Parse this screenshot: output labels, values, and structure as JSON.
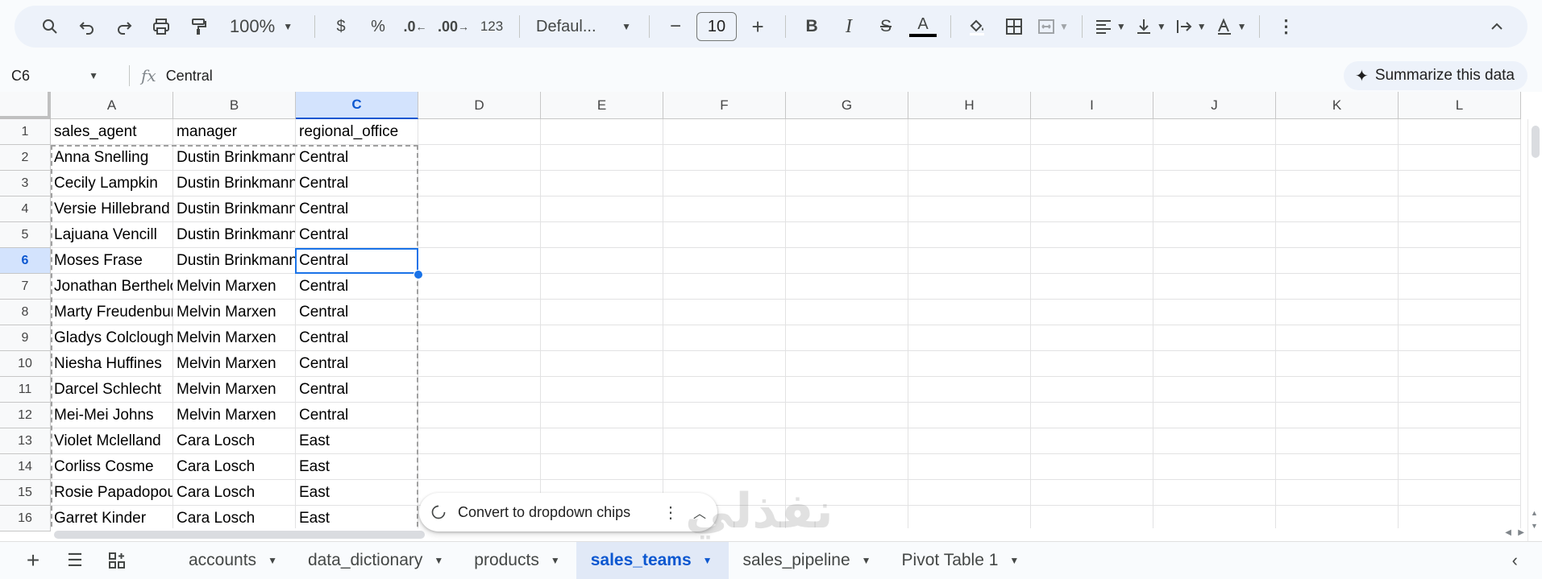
{
  "toolbar": {
    "zoom": "100%",
    "currency": "$",
    "percent": "%",
    "dec_decrease": ".0",
    "dec_increase": ".00",
    "number_format": "123",
    "font": "Defaul...",
    "font_size": "10",
    "minus": "−",
    "plus": "+",
    "bold": "B",
    "italic": "I",
    "strike": "S",
    "text_color_letter": "A"
  },
  "formula_bar": {
    "name_box": "C6",
    "fx": "fx",
    "value": "Central",
    "summarize_label": "Summarize this data"
  },
  "columns": [
    "A",
    "B",
    "C",
    "D",
    "E",
    "F",
    "G",
    "H",
    "I",
    "J",
    "K",
    "L"
  ],
  "selected_column": "C",
  "selected_row": 6,
  "rows": [
    {
      "n": "1",
      "cells": [
        "sales_agent",
        "manager",
        "regional_office"
      ]
    },
    {
      "n": "2",
      "cells": [
        "Anna Snelling",
        "Dustin Brinkmann",
        "Central"
      ]
    },
    {
      "n": "3",
      "cells": [
        "Cecily Lampkin",
        "Dustin Brinkmann",
        "Central"
      ]
    },
    {
      "n": "4",
      "cells": [
        "Versie Hillebrand",
        "Dustin Brinkmann",
        "Central"
      ]
    },
    {
      "n": "5",
      "cells": [
        "Lajuana Vencill",
        "Dustin Brinkmann",
        "Central"
      ]
    },
    {
      "n": "6",
      "cells": [
        "Moses Frase",
        "Dustin Brinkmann",
        "Central"
      ]
    },
    {
      "n": "7",
      "cells": [
        "Jonathan Berthelot",
        "Melvin Marxen",
        "Central"
      ]
    },
    {
      "n": "8",
      "cells": [
        "Marty Freudenburg",
        "Melvin Marxen",
        "Central"
      ]
    },
    {
      "n": "9",
      "cells": [
        "Gladys Colclough",
        "Melvin Marxen",
        "Central"
      ]
    },
    {
      "n": "10",
      "cells": [
        "Niesha Huffines",
        "Melvin Marxen",
        "Central"
      ]
    },
    {
      "n": "11",
      "cells": [
        "Darcel Schlecht",
        "Melvin Marxen",
        "Central"
      ]
    },
    {
      "n": "12",
      "cells": [
        "Mei-Mei Johns",
        "Melvin Marxen",
        "Central"
      ]
    },
    {
      "n": "13",
      "cells": [
        "Violet Mclelland",
        "Cara Losch",
        "East"
      ]
    },
    {
      "n": "14",
      "cells": [
        "Corliss Cosme",
        "Cara Losch",
        "East"
      ]
    },
    {
      "n": "15",
      "cells": [
        "Rosie Papadopoulos",
        "Cara Losch",
        "East"
      ]
    },
    {
      "n": "16",
      "cells": [
        "Garret Kinder",
        "Cara Losch",
        "East"
      ]
    }
  ],
  "popup": {
    "label": "Convert to dropdown chips"
  },
  "watermark": {
    "text": "نفذلي",
    "sub": ".com"
  },
  "sheet_tabs": [
    {
      "label": "accounts",
      "active": false
    },
    {
      "label": "data_dictionary",
      "active": false
    },
    {
      "label": "products",
      "active": false
    },
    {
      "label": "sales_teams",
      "active": true
    },
    {
      "label": "sales_pipeline",
      "active": false
    },
    {
      "label": "Pivot Table 1",
      "active": false
    }
  ],
  "colors": {
    "accent": "#0b57d0",
    "selection_bg": "#d3e3fd",
    "toolbar_bg": "#edf2fa"
  }
}
